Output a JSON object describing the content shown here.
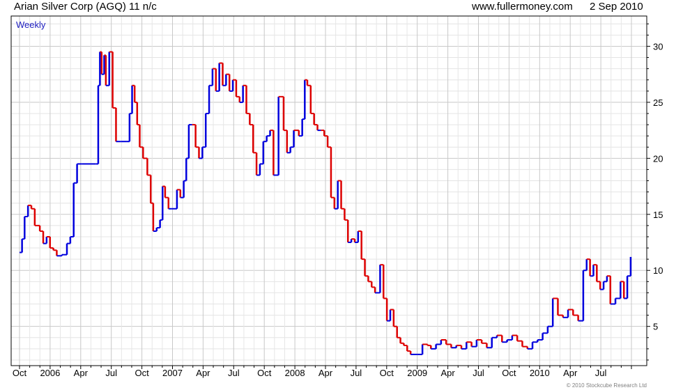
{
  "header": {
    "title": "Arian Silver Corp (AGQ) 11 n/c",
    "site": "www.fullermoney.com",
    "date": "2 Sep 2010"
  },
  "copyright": "© 2010 Stockcube Research Ltd",
  "chart_data": {
    "type": "bar",
    "style": "weekly price line, blue = up week, red = down week",
    "frequency_label": "Weekly",
    "ylim": [
      1.5,
      32.7
    ],
    "yticks": [
      "5",
      "10",
      "15",
      "20",
      "25",
      "30"
    ],
    "xlabels": [
      "Oct",
      "2006",
      "Apr",
      "Jul",
      "Oct",
      "2007",
      "Apr",
      "Jul",
      "Oct",
      "2008",
      "Apr",
      "Jul",
      "Oct",
      "2009",
      "Apr",
      "Jul",
      "Oct",
      "2010",
      "Apr",
      "Jul"
    ],
    "xlim_months": [
      0,
      60
    ],
    "grid": true,
    "colors": {
      "up": "#0000dd",
      "down": "#dd0000",
      "grid": "#d8d8d8"
    },
    "price_path": [
      [
        0.0,
        11.6
      ],
      [
        0.15,
        12.8
      ],
      [
        0.3,
        14.8
      ],
      [
        0.5,
        15.8
      ],
      [
        0.7,
        15.5
      ],
      [
        0.9,
        14.0
      ],
      [
        1.2,
        13.5
      ],
      [
        1.4,
        12.4
      ],
      [
        1.6,
        13.0
      ],
      [
        1.8,
        12.0
      ],
      [
        2.0,
        11.8
      ],
      [
        2.2,
        11.3
      ],
      [
        2.5,
        11.4
      ],
      [
        2.8,
        12.4
      ],
      [
        3.0,
        13.0
      ],
      [
        3.2,
        17.8
      ],
      [
        3.4,
        19.5
      ],
      [
        3.7,
        19.5
      ],
      [
        4.2,
        19.5
      ],
      [
        4.5,
        19.5
      ],
      [
        4.65,
        26.5
      ],
      [
        4.75,
        29.5
      ],
      [
        4.85,
        27.5
      ],
      [
        5.0,
        29.2
      ],
      [
        5.1,
        26.5
      ],
      [
        5.3,
        29.5
      ],
      [
        5.5,
        24.5
      ],
      [
        5.7,
        21.5
      ],
      [
        6.0,
        21.5
      ],
      [
        6.3,
        21.5
      ],
      [
        6.5,
        24.0
      ],
      [
        6.65,
        26.5
      ],
      [
        6.8,
        25.0
      ],
      [
        6.95,
        23.0
      ],
      [
        7.1,
        21.0
      ],
      [
        7.3,
        20.0
      ],
      [
        7.55,
        18.5
      ],
      [
        7.75,
        16.0
      ],
      [
        7.9,
        13.5
      ],
      [
        8.1,
        13.8
      ],
      [
        8.3,
        14.5
      ],
      [
        8.45,
        17.5
      ],
      [
        8.6,
        16.5
      ],
      [
        8.8,
        15.5
      ],
      [
        9.0,
        15.5
      ],
      [
        9.3,
        17.2
      ],
      [
        9.5,
        16.5
      ],
      [
        9.7,
        18.0
      ],
      [
        9.85,
        20.0
      ],
      [
        10.0,
        23.0
      ],
      [
        10.2,
        23.0
      ],
      [
        10.4,
        21.0
      ],
      [
        10.6,
        20.0
      ],
      [
        10.8,
        21.0
      ],
      [
        11.0,
        24.0
      ],
      [
        11.2,
        26.5
      ],
      [
        11.4,
        28.0
      ],
      [
        11.6,
        26.0
      ],
      [
        11.8,
        28.5
      ],
      [
        12.0,
        26.5
      ],
      [
        12.2,
        27.5
      ],
      [
        12.4,
        26.0
      ],
      [
        12.6,
        27.0
      ],
      [
        12.8,
        25.5
      ],
      [
        13.0,
        25.0
      ],
      [
        13.2,
        26.5
      ],
      [
        13.4,
        24.0
      ],
      [
        13.6,
        23.0
      ],
      [
        13.8,
        20.5
      ],
      [
        14.0,
        18.5
      ],
      [
        14.2,
        19.5
      ],
      [
        14.4,
        21.5
      ],
      [
        14.6,
        22.0
      ],
      [
        14.8,
        22.5
      ],
      [
        15.0,
        18.5
      ],
      [
        15.3,
        25.5
      ],
      [
        15.6,
        22.5
      ],
      [
        15.8,
        20.5
      ],
      [
        16.0,
        21.0
      ],
      [
        16.2,
        22.5
      ],
      [
        16.5,
        22.0
      ],
      [
        16.7,
        23.5
      ],
      [
        16.85,
        27.0
      ],
      [
        17.0,
        26.5
      ],
      [
        17.2,
        24.0
      ],
      [
        17.4,
        23.0
      ],
      [
        17.6,
        22.5
      ],
      [
        17.8,
        22.5
      ],
      [
        18.0,
        22.0
      ],
      [
        18.2,
        21.0
      ],
      [
        18.4,
        16.5
      ],
      [
        18.6,
        15.5
      ],
      [
        18.8,
        18.0
      ],
      [
        19.0,
        15.5
      ],
      [
        19.2,
        14.5
      ],
      [
        19.4,
        12.5
      ],
      [
        19.6,
        12.8
      ],
      [
        19.8,
        12.5
      ],
      [
        20.0,
        13.5
      ],
      [
        20.2,
        11.0
      ],
      [
        20.4,
        9.5
      ],
      [
        20.6,
        9.0
      ],
      [
        20.8,
        8.5
      ],
      [
        21.0,
        8.0
      ],
      [
        21.3,
        10.5
      ],
      [
        21.5,
        7.5
      ],
      [
        21.7,
        5.5
      ],
      [
        21.9,
        6.5
      ],
      [
        22.1,
        5.0
      ],
      [
        22.3,
        4.0
      ],
      [
        22.5,
        3.5
      ],
      [
        22.7,
        3.3
      ],
      [
        22.9,
        2.8
      ],
      [
        23.1,
        2.5
      ],
      [
        23.5,
        2.5
      ],
      [
        23.8,
        3.4
      ],
      [
        24.1,
        3.3
      ],
      [
        24.3,
        3.0
      ],
      [
        24.6,
        3.4
      ],
      [
        24.9,
        3.8
      ],
      [
        25.2,
        3.4
      ],
      [
        25.5,
        3.1
      ],
      [
        25.8,
        3.3
      ],
      [
        26.1,
        3.0
      ],
      [
        26.4,
        3.6
      ],
      [
        26.7,
        3.2
      ],
      [
        27.0,
        3.8
      ],
      [
        27.3,
        3.5
      ],
      [
        27.6,
        3.1
      ],
      [
        27.9,
        4.0
      ],
      [
        28.2,
        4.2
      ],
      [
        28.5,
        3.6
      ],
      [
        28.8,
        3.8
      ],
      [
        29.1,
        4.2
      ],
      [
        29.4,
        3.7
      ],
      [
        29.7,
        3.2
      ],
      [
        30.0,
        3.0
      ],
      [
        30.3,
        3.6
      ],
      [
        30.6,
        3.8
      ],
      [
        30.9,
        4.4
      ],
      [
        31.2,
        5.0
      ],
      [
        31.5,
        7.5
      ],
      [
        31.8,
        6.0
      ],
      [
        32.1,
        5.8
      ],
      [
        32.4,
        6.5
      ],
      [
        32.7,
        6.0
      ],
      [
        33.0,
        5.5
      ],
      [
        33.3,
        10.0
      ],
      [
        33.5,
        11.0
      ],
      [
        33.7,
        9.5
      ],
      [
        33.9,
        10.5
      ],
      [
        34.1,
        9.0
      ],
      [
        34.3,
        8.3
      ],
      [
        34.5,
        9.0
      ],
      [
        34.7,
        9.5
      ],
      [
        34.9,
        7.0
      ],
      [
        35.2,
        7.5
      ],
      [
        35.5,
        9.0
      ],
      [
        35.7,
        7.5
      ],
      [
        35.9,
        9.5
      ],
      [
        36.1,
        11.2
      ]
    ]
  }
}
